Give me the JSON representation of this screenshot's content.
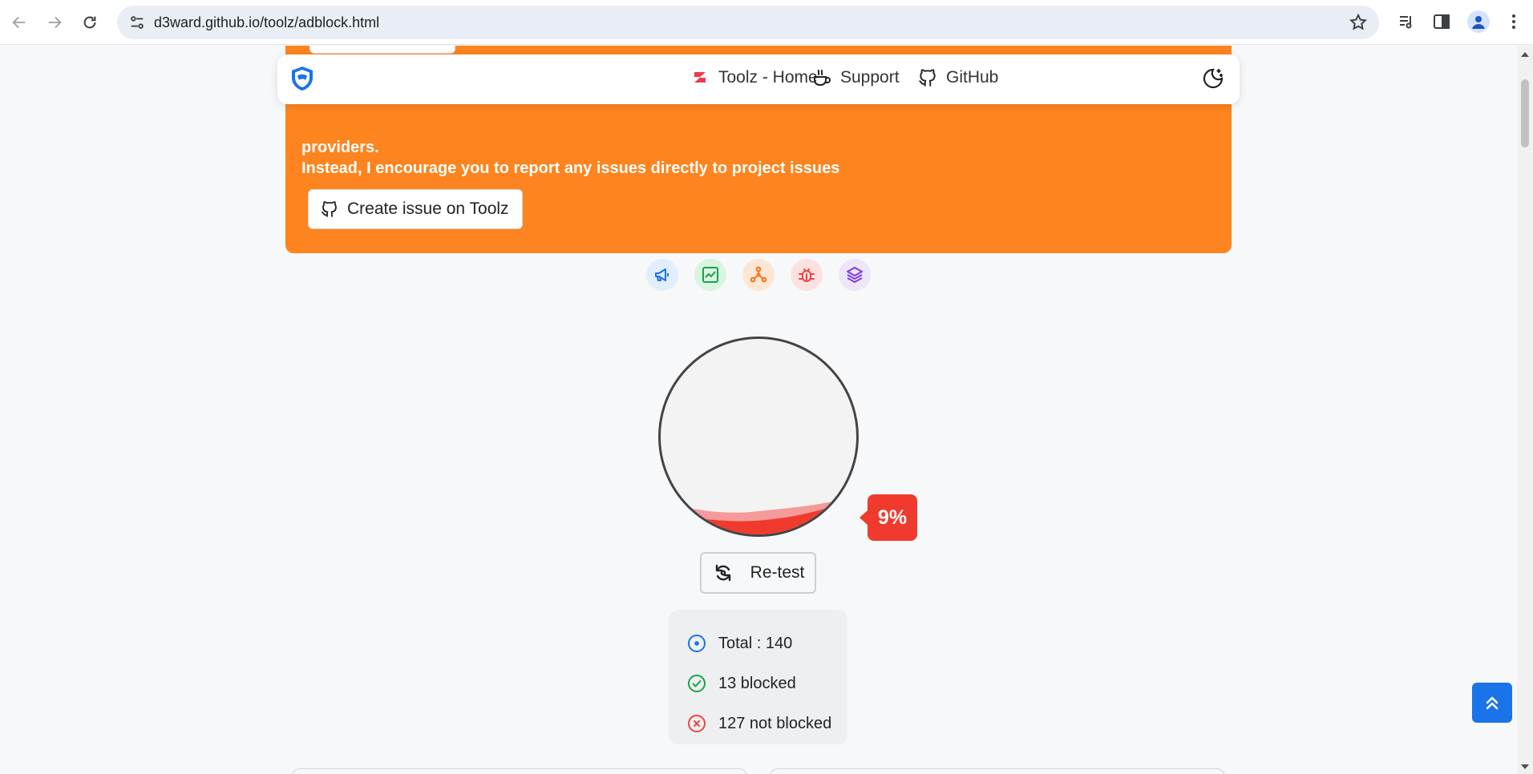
{
  "browser": {
    "url": "d3ward.github.io/toolz/adblock.html",
    "icons": [
      "back-icon",
      "forward-icon",
      "reload-icon",
      "site-settings-icon",
      "bookmark-star-icon",
      "media-queue-icon",
      "side-panel-icon",
      "profile-icon",
      "more-menu-icon"
    ]
  },
  "banner": {
    "cut_text": "providers.",
    "message": "Instead, I encourage you to report any issues directly to project issues",
    "issue_button": "Create issue on Toolz",
    "color": "#fd841f"
  },
  "navbar": {
    "links": [
      {
        "label": "Toolz - Home",
        "icon": "toolz-logo-icon"
      },
      {
        "label": "Support",
        "icon": "coffee-icon"
      },
      {
        "label": "GitHub",
        "icon": "github-icon"
      }
    ],
    "theme_icon": "moon-icon"
  },
  "categories": [
    {
      "name": "ads",
      "icon": "megaphone-icon",
      "color": "#1a73e8",
      "bg": "#e1eefc"
    },
    {
      "name": "analytics",
      "icon": "chart-icon",
      "color": "#16a34a",
      "bg": "#d9f4e1"
    },
    {
      "name": "trackers",
      "icon": "network-icon",
      "color": "#f97316",
      "bg": "#fde6d4"
    },
    {
      "name": "error-trackers",
      "icon": "bug-icon",
      "color": "#ef4444",
      "bg": "#fde1e1"
    },
    {
      "name": "mix",
      "icon": "layers-icon",
      "color": "#7c3aed",
      "bg": "#ece6f7"
    }
  ],
  "result": {
    "percent": 9,
    "percent_label": "9%",
    "retest_label": "Re-test",
    "total_label": "Total : 140",
    "blocked_label": "13 blocked",
    "not_blocked_label": "127 not blocked"
  },
  "colors": {
    "blocked": "#16a34a",
    "not_blocked": "#ef4444",
    "total": "#1a73e8",
    "badge": "#f03a2e",
    "to_top": "#1a73e8"
  }
}
